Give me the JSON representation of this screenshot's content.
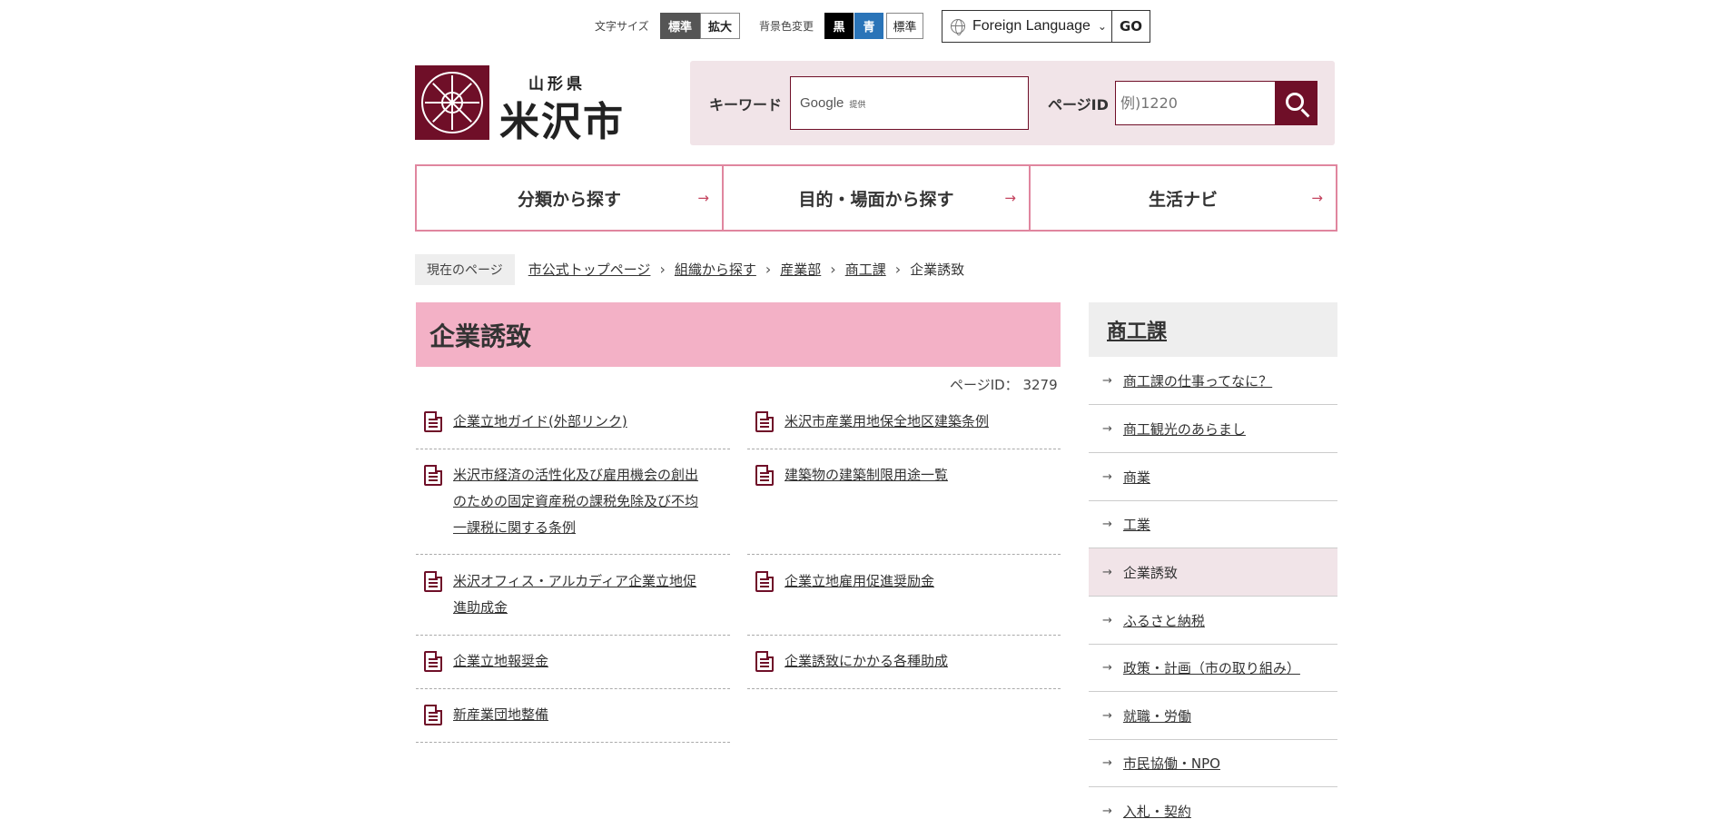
{
  "utility": {
    "font_size_label": "文字サイズ",
    "font_standard": "標準",
    "font_large": "拡大",
    "bg_label": "背景色変更",
    "bg_black": "黒",
    "bg_blue": "青",
    "bg_standard": "標準",
    "language": "Foreign Language",
    "go": "GO"
  },
  "header": {
    "prefecture": "山形県",
    "city": "米沢市",
    "keyword_label": "キーワード",
    "google_text": "Google",
    "google_provided": "提供",
    "page_id_label": "ページID",
    "page_id_placeholder": "例)1220"
  },
  "gnav": {
    "item1": "分類から探す",
    "item2": "目的・場面から探す",
    "item3": "生活ナビ"
  },
  "breadcrumb": {
    "here": "現在のページ",
    "crumb1": "市公式トップページ",
    "crumb2": "組織から探す",
    "crumb3": "産業部",
    "crumb4": "商工課",
    "current": "企業誘致"
  },
  "main": {
    "title": "企業誘致",
    "page_id": "ページID： 3279",
    "links": {
      "l1": "企業立地ガイド(外部リンク)",
      "l2": "米沢市産業用地保全地区建築条例",
      "l3a": "米沢市経済の活性化及び雇用機会の創出",
      "l3b": "のための固定資産税の課税免除及び不均",
      "l3c": "一課税に関する条例",
      "l4": "建築物の建築制限用途一覧",
      "l5a": "米沢オフィス・アルカディア企業立地促",
      "l5b": "進助成金",
      "l6": "企業立地雇用促進奨励金",
      "l7": "企業立地報奨金",
      "l8": "企業誘致にかかる各種助成",
      "l9": "新産業団地整備"
    }
  },
  "sidebar": {
    "title": "商工課",
    "items": {
      "s1": "商工課の仕事ってなに？",
      "s2": "商工観光のあらまし",
      "s3": "商業",
      "s4": "工業",
      "s5": "企業誘致",
      "s6": "ふるさと納税",
      "s7": "政策・計画（市の取り組み）",
      "s8": "就職・労働",
      "s9": "市民協働・NPO",
      "s10": "入札・契約"
    }
  },
  "icons": {
    "globe": "globe-icon",
    "search": "search-icon",
    "document": "document-icon",
    "arrow": "arrow-right-icon"
  },
  "colors": {
    "brand": "#6f0f28",
    "title_pink": "#f3b1c6",
    "nav_border": "#e0869f",
    "blue_bg": "#2a74b8"
  }
}
